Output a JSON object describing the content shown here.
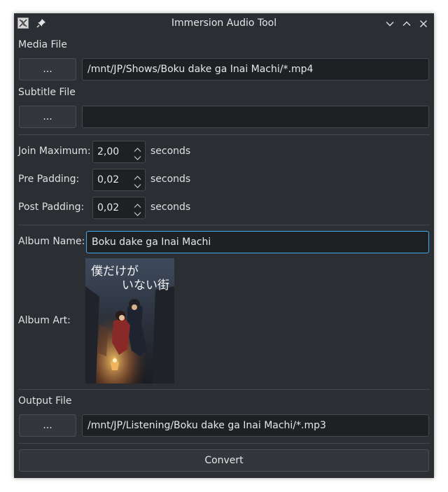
{
  "window": {
    "title": "Immersion Audio Tool"
  },
  "icons": {
    "app": "app-icon",
    "pin": "pin-icon",
    "minimize": "chevron-down-icon",
    "maximize": "chevron-up-icon",
    "close": "close-icon"
  },
  "media": {
    "label": "Media File",
    "browse_label": "...",
    "path": "/mnt/JP/Shows/Boku dake ga Inai Machi/*.mp4"
  },
  "subtitle": {
    "label": "Subtitle File",
    "browse_label": "...",
    "path": ""
  },
  "timing": {
    "join_max": {
      "label": "Join Maximum:",
      "value": "2,00",
      "unit": "seconds"
    },
    "pre_padding": {
      "label": "Pre Padding:",
      "value": "0,02",
      "unit": "seconds"
    },
    "post_padding": {
      "label": "Post Padding:",
      "value": "0,02",
      "unit": "seconds"
    }
  },
  "album": {
    "name_label": "Album Name:",
    "name_value": "Boku dake ga Inai Machi",
    "art_label": "Album Art:",
    "art_title_line1": "僕だけが",
    "art_title_line2": "いない街"
  },
  "output": {
    "label": "Output File",
    "browse_label": "...",
    "path": "/mnt/JP/Listening/Boku dake ga Inai Machi/*.mp3"
  },
  "actions": {
    "convert_label": "Convert"
  },
  "colors": {
    "window_bg": "#2b2e32",
    "field_bg": "#1e2024",
    "button_bg": "#33363b",
    "focus": "#3daee9"
  }
}
